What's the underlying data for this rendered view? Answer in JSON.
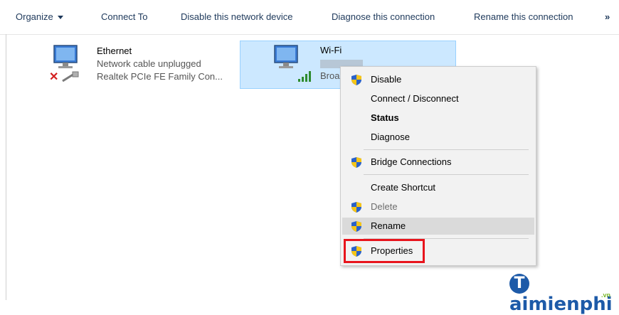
{
  "toolbar": {
    "organize": "Organize",
    "connect_to": "Connect To",
    "disable_device": "Disable this network device",
    "diagnose": "Diagnose this connection",
    "rename": "Rename this connection",
    "more": "»"
  },
  "adapters": [
    {
      "name": "Ethernet",
      "status": "Network cable unplugged",
      "device": "Realtek PCIe FE Family Con...",
      "icon": "network-adapter-disconnected-icon"
    },
    {
      "name": "Wi-Fi",
      "status": "",
      "device": "Broa",
      "icon": "wifi-adapter-icon",
      "selected": true
    }
  ],
  "context_menu": {
    "items": [
      {
        "label": "Disable",
        "shield": true
      },
      {
        "label": "Connect / Disconnect",
        "shield": false
      },
      {
        "label": "Status",
        "shield": false,
        "bold": true
      },
      {
        "label": "Diagnose",
        "shield": false
      },
      {
        "label": "Bridge Connections",
        "shield": true
      },
      {
        "label": "Create Shortcut",
        "shield": false
      },
      {
        "label": "Delete",
        "shield": true,
        "disabled": true
      },
      {
        "label": "Rename",
        "shield": true,
        "hovered": true
      },
      {
        "label": "Properties",
        "shield": true,
        "highlighted": true
      }
    ]
  },
  "watermark": {
    "letter": "T",
    "text": "aimienphi",
    "suffix": ".vn"
  },
  "colors": {
    "toolbar_text": "#1e395b",
    "selection_bg": "#cce8ff",
    "highlight_red": "#e8141c",
    "watermark_blue": "#1d5aa8"
  }
}
